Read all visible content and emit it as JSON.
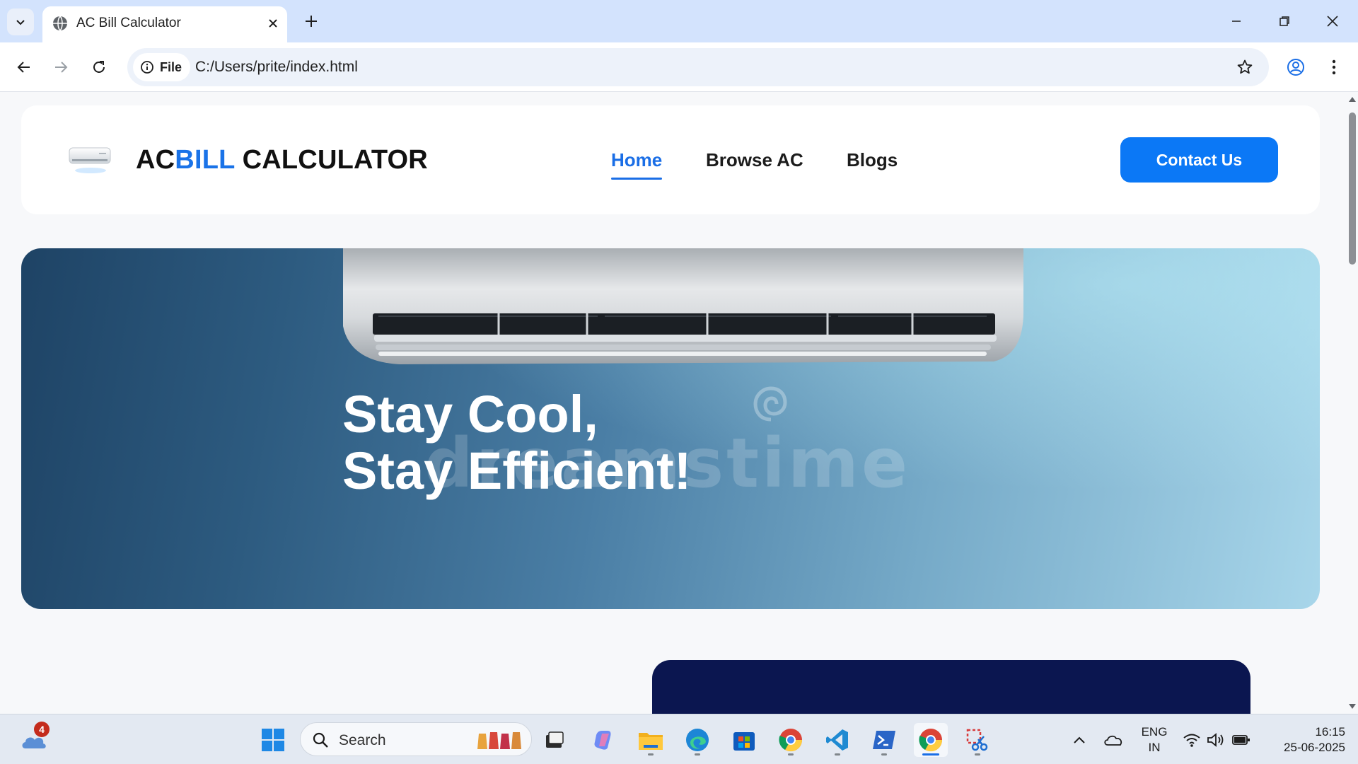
{
  "browser": {
    "tab_title": "AC Bill Calculator",
    "site_info_label": "File",
    "url": "C:/Users/prite/index.html"
  },
  "site": {
    "logo_prefix": "AC",
    "logo_accent": "BILL",
    "logo_suffix": " CALCULATOR",
    "nav": [
      {
        "label": "Home",
        "active": true
      },
      {
        "label": "Browse AC",
        "active": false
      },
      {
        "label": "Blogs",
        "active": false
      }
    ],
    "cta_label": "Contact Us",
    "colors": {
      "accent": "#1a73e8",
      "button": "#0b78f6",
      "card": "#0b1650"
    }
  },
  "hero": {
    "line1": "Stay Cool,",
    "line2": "Stay Efficient!",
    "watermark": "dreamstime"
  },
  "taskbar": {
    "weather_badge": "4",
    "search_placeholder": "Search",
    "lang_line1": "ENG",
    "lang_line2": "IN",
    "time": "16:15",
    "date": "25-06-2025",
    "apps": [
      "task-view",
      "copilot",
      "file-explorer",
      "edge",
      "microsoft-store",
      "chrome",
      "vscode",
      "powershell",
      "chrome-active",
      "snipping-tool"
    ]
  }
}
